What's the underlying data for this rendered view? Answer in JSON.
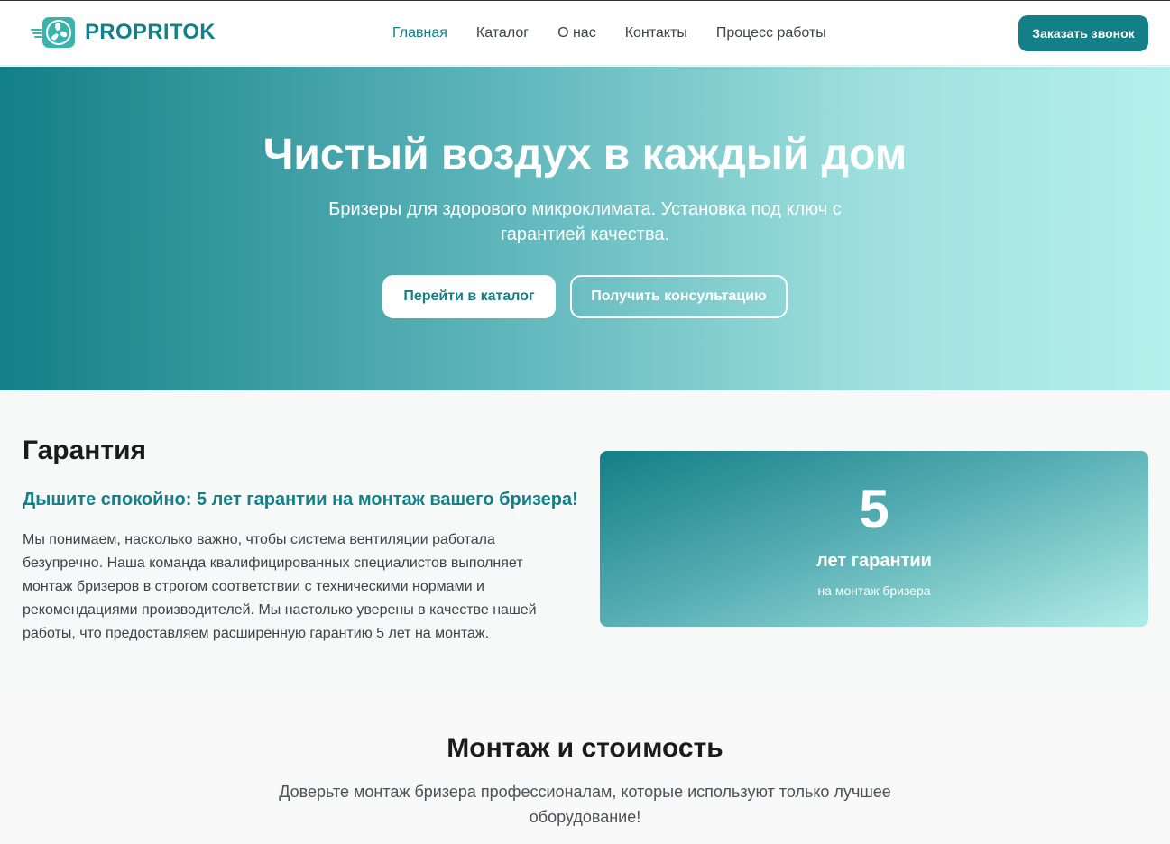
{
  "header": {
    "logo_text": "PROPRITOK",
    "nav": [
      {
        "label": "Главная",
        "active": true
      },
      {
        "label": "Каталог",
        "active": false
      },
      {
        "label": "О нас",
        "active": false
      },
      {
        "label": "Контакты",
        "active": false
      },
      {
        "label": "Процесс работы",
        "active": false
      }
    ],
    "call_button": "Заказать звонок"
  },
  "hero": {
    "title": "Чистый воздух в каждый дом",
    "subtitle": "Бризеры для здорового микроклимата. Установка под ключ с гарантией качества.",
    "primary_button": "Перейти в каталог",
    "secondary_button": "Получить консультацию"
  },
  "warranty": {
    "title": "Гарантия",
    "subtitle": "Дышите спокойно: 5 лет гарантии на монтаж вашего бризера!",
    "text": "Мы понимаем, насколько важно, чтобы система вентиляции работала безупречно. Наша команда квалифицированных специалистов выполняет монтаж бризеров в строгом соответствии с техническими нормами и рекомендациями производителей. Мы настолько уверены в качестве нашей работы, что предоставляем расширенную гарантию 5 лет на монтаж.",
    "card": {
      "number": "5",
      "label": "лет гарантии",
      "note": "на монтаж бризера"
    }
  },
  "montage": {
    "title": "Монтаж и стоимость",
    "text": "Доверьте монтаж бризера профессионалам, которые используют только лучшее оборудование!"
  },
  "colors": {
    "brand": "#137f86",
    "hero_end": "#b5f0eb",
    "background": "#f7f8f8"
  },
  "icons": {
    "logo": "fan-icon"
  }
}
